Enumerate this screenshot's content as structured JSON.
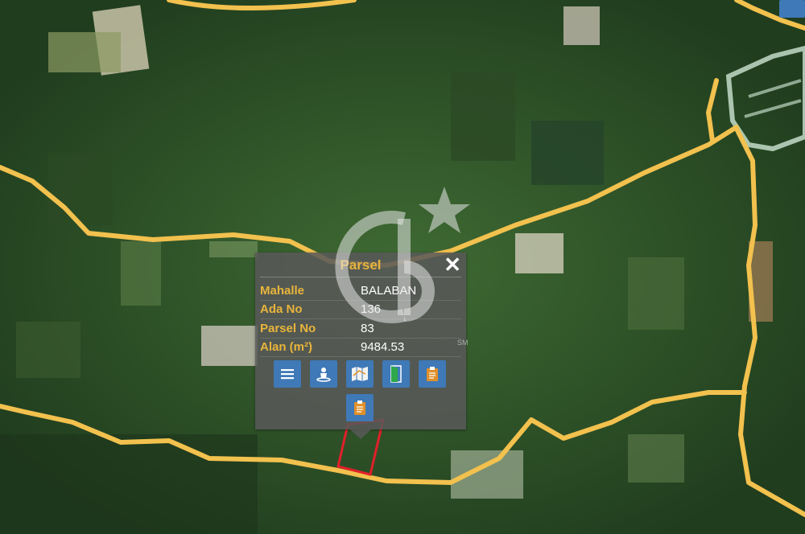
{
  "popup": {
    "title": "Parsel",
    "close_icon": "close-icon",
    "rows": [
      {
        "label": "Mahalle",
        "value": "BALABAN"
      },
      {
        "label": "Ada No",
        "value": "136"
      },
      {
        "label": "Parsel No",
        "value": "83"
      },
      {
        "label": "Alan (m²)",
        "value": "9484.53"
      }
    ],
    "buttons": [
      {
        "icon": "list-icon"
      },
      {
        "icon": "map-pin-person-icon"
      },
      {
        "icon": "folded-map-icon"
      },
      {
        "icon": "door-icon"
      },
      {
        "icon": "clipboard-icon"
      },
      {
        "icon": "clipboard-icon"
      }
    ]
  },
  "watermark": {
    "sm_text": "SM"
  },
  "colors": {
    "road": "#f2c14e",
    "parcel": "#e0202a",
    "button": "#3f79b7",
    "label": "#e8b43c"
  }
}
